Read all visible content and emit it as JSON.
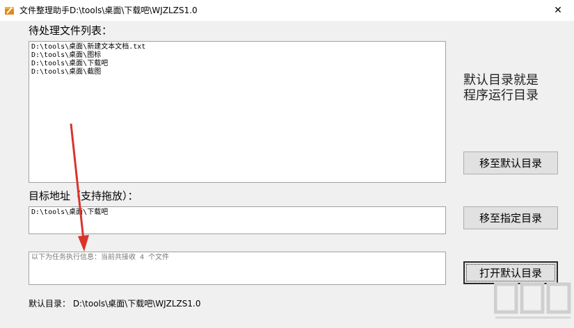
{
  "window": {
    "title": "文件整理助手D:\\tools\\桌面\\下载吧\\WJZLZS1.0",
    "close_glyph": "✕"
  },
  "pending_list": {
    "label": "待处理文件列表：",
    "items": [
      "D:\\tools\\桌面\\新建文本文档.txt",
      "D:\\tools\\桌面\\图标",
      "D:\\tools\\桌面\\下载吧",
      "D:\\tools\\桌面\\截图"
    ]
  },
  "hint": {
    "line1": "默认目录就是",
    "line2": "程序运行目录"
  },
  "buttons": {
    "move_default": "移至默认目录",
    "move_specified": "移至指定目录",
    "open_default": "打开默认目录"
  },
  "target": {
    "label": "目标地址（支持拖放）：",
    "value": "D:\\tools\\桌面\\下载吧"
  },
  "task_info": {
    "text": "以下为任务执行信息：当前共接收 4 个文件"
  },
  "status": {
    "text": "默认目录： D:\\tools\\桌面\\下载吧\\WJZLZS1.0"
  },
  "watermark": {
    "text": "下载吧"
  },
  "colors": {
    "arrow": "#d9342b",
    "watermark": "#cccccc"
  }
}
